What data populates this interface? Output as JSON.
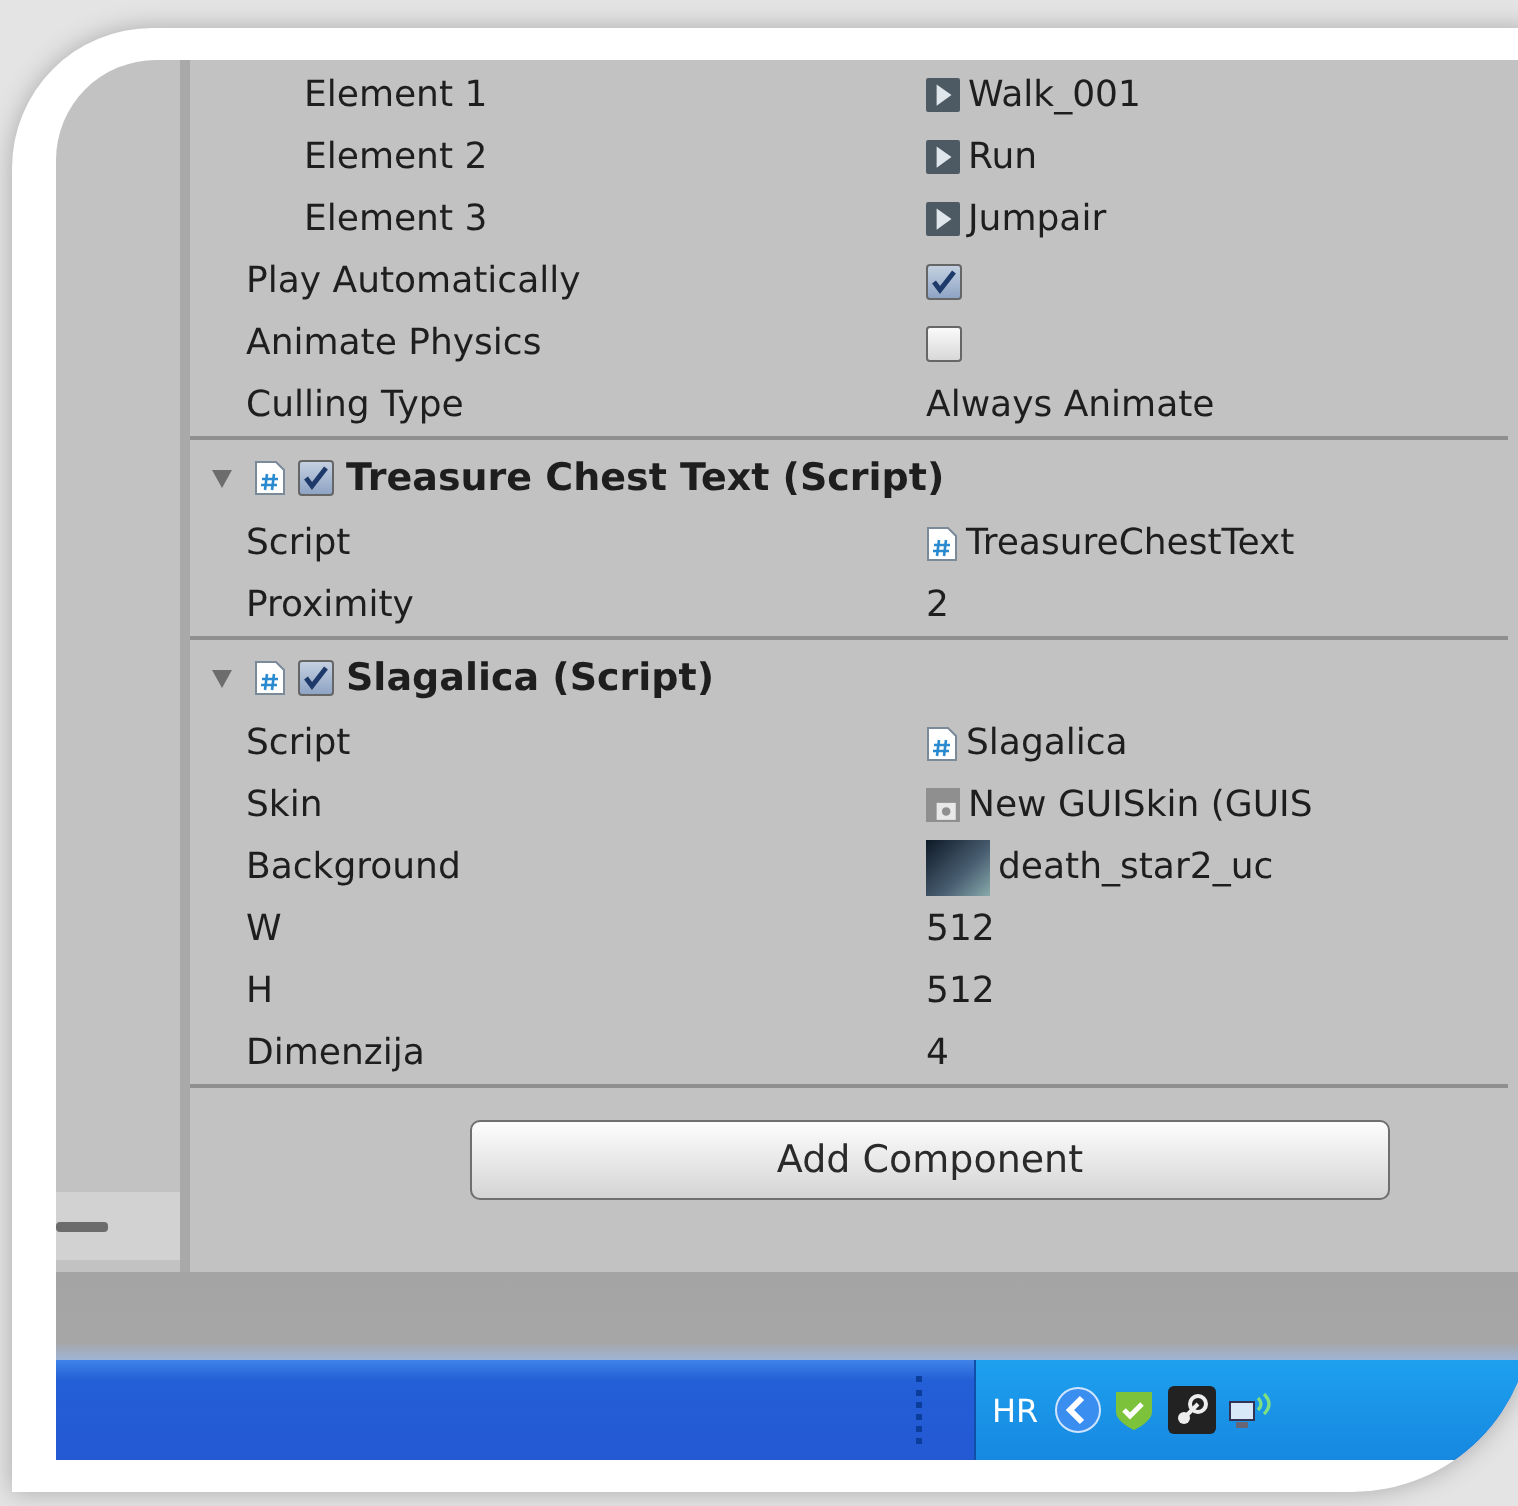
{
  "elements": [
    {
      "label": "Element 1",
      "value": "Walk_001"
    },
    {
      "label": "Element 2",
      "value": "Run"
    },
    {
      "label": "Element 3",
      "value": "Jumpair"
    }
  ],
  "properties": [
    {
      "kind": "checkbox",
      "label": "Play Automatically",
      "checked": true
    },
    {
      "kind": "checkbox",
      "label": "Animate Physics",
      "checked": false
    },
    {
      "kind": "text",
      "label": "Culling Type",
      "value": "Always Animate"
    }
  ],
  "components": [
    {
      "title": "Treasure Chest Text (Script)",
      "expanded": true,
      "enabled": true,
      "fields": [
        {
          "kind": "script",
          "label": "Script",
          "value": "TreasureChestText"
        },
        {
          "kind": "text",
          "label": "Proximity",
          "value": "2"
        }
      ]
    },
    {
      "title": "Slagalica (Script)",
      "expanded": true,
      "enabled": true,
      "fields": [
        {
          "kind": "script",
          "label": "Script",
          "value": "Slagalica"
        },
        {
          "kind": "skin",
          "label": "Skin",
          "value": "New GUISkin (GUIS"
        },
        {
          "kind": "texture",
          "label": "Background",
          "value": "death_star2_uc"
        },
        {
          "kind": "text",
          "label": "W",
          "value": "512"
        },
        {
          "kind": "text",
          "label": "H",
          "value": "512"
        },
        {
          "kind": "text",
          "label": "Dimenzija",
          "value": "4"
        }
      ]
    }
  ],
  "add_component_button": "Add Component",
  "taskbar": {
    "language": "HR"
  }
}
